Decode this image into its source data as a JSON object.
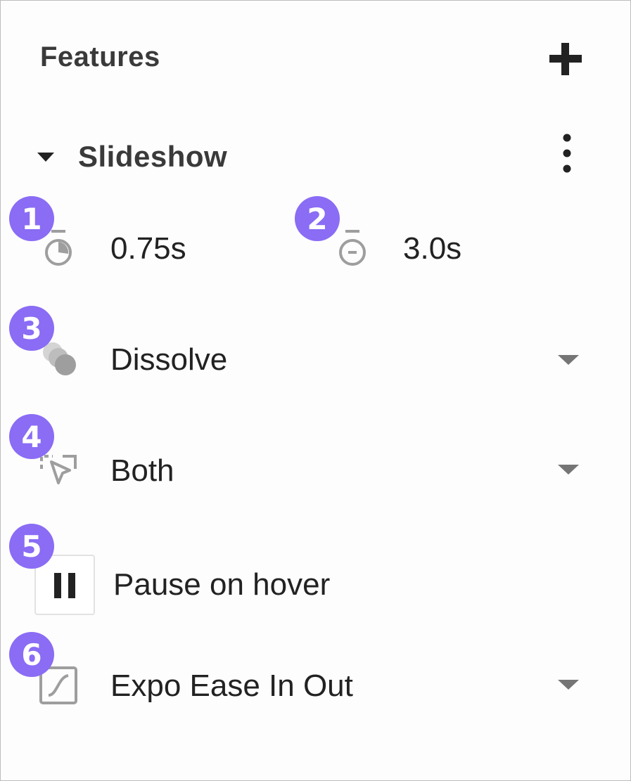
{
  "panel": {
    "title": "Features",
    "add_icon": "plus-icon"
  },
  "section": {
    "title": "Slideshow",
    "expand_icon": "triangle-down-icon",
    "menu_icon": "kebab-vertical-icon"
  },
  "badges": [
    "1",
    "2",
    "3",
    "4",
    "5",
    "6"
  ],
  "settings": {
    "transition_duration": {
      "value": "0.75s",
      "icon": "timer-icon"
    },
    "slide_duration": {
      "value": "3.0s",
      "icon": "timer-icon"
    },
    "transition": {
      "value": "Dissolve",
      "icon": "dissolve-icon"
    },
    "trigger": {
      "value": "Both",
      "icon": "cursor-select-icon"
    },
    "pause": {
      "label": "Pause on hover",
      "icon": "pause-icon"
    },
    "easing": {
      "value": "Expo Ease In Out",
      "icon": "easing-curve-icon"
    }
  },
  "colors": {
    "badge": "#8a6cf5",
    "icon_gray": "#9e9e9e",
    "text": "#222222"
  }
}
